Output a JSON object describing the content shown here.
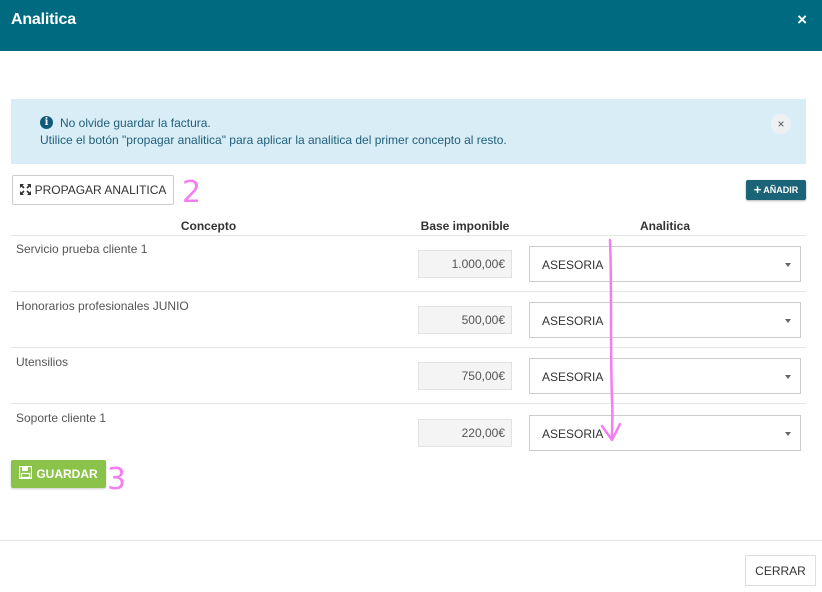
{
  "window": {
    "title": "Analitica",
    "close_label": "×"
  },
  "alert": {
    "line1": "No olvide guardar la factura.",
    "line2": "Utilice el botón \"propagar analitica\" para aplicar la analitica del primer concepto al resto.",
    "close_label": "×"
  },
  "toolbar": {
    "propagar_label": "PROPAGAR ANALITICA",
    "anadir_label": "AÑADIR"
  },
  "table": {
    "headers": {
      "concepto": "Concepto",
      "base": "Base imponible",
      "analitica": "Analitica"
    },
    "rows": [
      {
        "concepto": "Servicio prueba cliente 1",
        "base": "1.000,00€",
        "analitica": "ASESORIA"
      },
      {
        "concepto": "Honorarios profesionales JUNIO",
        "base": "500,00€",
        "analitica": "ASESORIA"
      },
      {
        "concepto": "Utensilios",
        "base": "750,00€",
        "analitica": "ASESORIA"
      },
      {
        "concepto": "Soporte cliente 1",
        "base": "220,00€",
        "analitica": "ASESORIA"
      }
    ]
  },
  "actions": {
    "guardar_label": "GUARDAR",
    "cerrar_label": "CERRAR"
  },
  "annotations": {
    "label_2": "2",
    "label_3": "3",
    "color": "#f47ef0"
  },
  "colors": {
    "header": "#006b80",
    "alert_bg": "#d9edf7",
    "guardar": "#8bc34a",
    "anadir": "#1b6376"
  }
}
